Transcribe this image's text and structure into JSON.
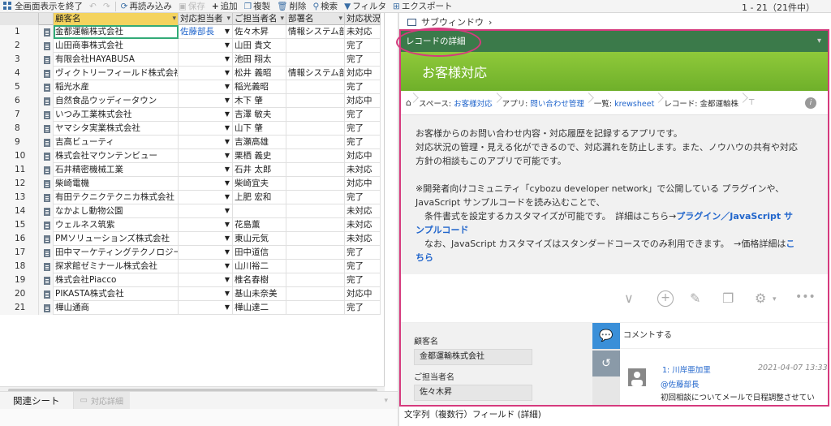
{
  "toolbar": {
    "exit_fullscreen": "全画面表示を終了",
    "reload": "再読み込み",
    "save": "保存",
    "add": "追加",
    "duplicate": "複製",
    "delete": "削除",
    "search": "検索",
    "filter": "フィルタ",
    "export": "エクスポート",
    "range": "1 - 21（21件中）"
  },
  "grid": {
    "headers": [
      "顧客名",
      "対応担当者",
      "ご担当者名",
      "部署名",
      "対応状況"
    ],
    "rows": [
      {
        "n": "1",
        "name": "金都運輸株式会社",
        "rep": "佐藤部長",
        "contact": "佐々木昇",
        "dept": "情報システム部",
        "status": "未対応"
      },
      {
        "n": "2",
        "name": "山田商事株式会社",
        "rep": "",
        "contact": "山田 貴文",
        "dept": "",
        "status": "完了"
      },
      {
        "n": "3",
        "name": "有限会社HAYABUSA",
        "rep": "",
        "contact": "池田 翔太",
        "dept": "",
        "status": "完了"
      },
      {
        "n": "4",
        "name": "ヴィクトリーフィールド株式会社",
        "rep": "",
        "contact": "松井 義昭",
        "dept": "情報システム部",
        "status": "対応中"
      },
      {
        "n": "5",
        "name": "稲光水産",
        "rep": "",
        "contact": "稲光義昭",
        "dept": "",
        "status": "完了"
      },
      {
        "n": "6",
        "name": " 自然食品ウッディータウン",
        "rep": "",
        "contact": "木下 肇",
        "dept": "",
        "status": "対応中"
      },
      {
        "n": "7",
        "name": "いつみ工業株式会社",
        "rep": "",
        "contact": "吉澤 敏夫",
        "dept": "",
        "status": "完了"
      },
      {
        "n": "8",
        "name": "ヤマシタ実業株式会社",
        "rep": "",
        "contact": "山下 肇",
        "dept": "",
        "status": "完了"
      },
      {
        "n": "9",
        "name": "吉高ビューティ",
        "rep": "",
        "contact": "吉瀬高雄",
        "dept": "",
        "status": "完了"
      },
      {
        "n": "10",
        "name": "株式会社マウンテンビュー",
        "rep": "",
        "contact": "栗栖 義史",
        "dept": "",
        "status": "対応中"
      },
      {
        "n": "11",
        "name": "石井精密機械工業",
        "rep": "",
        "contact": "石井 太郎",
        "dept": "",
        "status": "未対応"
      },
      {
        "n": "12",
        "name": "柴崎電機",
        "rep": "",
        "contact": "柴崎宜夫",
        "dept": "",
        "status": "対応中"
      },
      {
        "n": "13",
        "name": "有田テクニクテクニカ株式会社",
        "rep": "",
        "contact": "上肥 宏和",
        "dept": "",
        "status": "完了"
      },
      {
        "n": "14",
        "name": "なかよし動物公園",
        "rep": "",
        "contact": "",
        "dept": "",
        "status": "未対応"
      },
      {
        "n": "15",
        "name": "ウェルネス筑紫",
        "rep": "",
        "contact": "花島薫",
        "dept": "",
        "status": "未対応"
      },
      {
        "n": "16",
        "name": "PMソリューションズ株式会社",
        "rep": "",
        "contact": "東山元気",
        "dept": "",
        "status": "未対応"
      },
      {
        "n": "17",
        "name": "田中マーケティングテクノロジー",
        "rep": "",
        "contact": "田中道信",
        "dept": "",
        "status": "完了"
      },
      {
        "n": "18",
        "name": "探求館ゼミナール株式会社",
        "rep": "",
        "contact": "山川裕二",
        "dept": "",
        "status": "完了"
      },
      {
        "n": "19",
        "name": "株式会社Piacco",
        "rep": "",
        "contact": "椎名春樹",
        "dept": "",
        "status": "完了"
      },
      {
        "n": "20",
        "name": "PIKASTA株式会社",
        "rep": "",
        "contact": "基山未奈美",
        "dept": "",
        "status": "対応中"
      },
      {
        "n": "21",
        "name": "樺山通商",
        "rep": "",
        "contact": "樺山達二",
        "dept": "",
        "status": "完了"
      }
    ]
  },
  "bottom": {
    "related_sheet": "関連シート",
    "detail_tab": "対応詳細"
  },
  "subwindow": {
    "title": "サブウィンドウ"
  },
  "detail": {
    "header": "レコードの詳細",
    "app_title": "お客様対応",
    "breadcrumbs": [
      {
        "prefix": "スペース: ",
        "link": "お客様対応"
      },
      {
        "prefix": "アプリ: ",
        "link": "問い合わせ管理"
      },
      {
        "prefix": "一覧: ",
        "link": "krewsheet"
      },
      {
        "prefix": "レコード: ",
        "link": "",
        "plain": "金都運輸株"
      }
    ],
    "desc_lines": [
      "お客様からのお問い合わせ内容・対応履歴を記録するアプリです。",
      "対応状況の管理・見える化ができるので、対応漏れを防止します。また、ノウハウの共有や対応",
      "方針の相談もこのアプリで可能です。"
    ],
    "dev_line1": "※開発者向けコミュニティ「cybozu developer network」で公開している プラグインや、",
    "dev_line2": "JavaScript サンプルコードを読み込むことで、",
    "dev_line3a": "　条件書式を設定するカスタマイズが可能です。　詳細はこちら→",
    "dev_link1": "プラグイン",
    "dev_slash": "／",
    "dev_link2a": "JavaScript サ",
    "dev_link2b": "ンプルコード",
    "dev_line4": "　なお、JavaScript カスタマイズはスタンダードコースでのみ利用できます。　→価格詳細は",
    "dev_link3a": "こ",
    "dev_link3b": "ちら"
  },
  "form": {
    "customer_label": "顧客名",
    "customer_value": "金都運輸株式会社",
    "contact_label": "ご担当者名",
    "contact_value": "佐々木昇"
  },
  "comments": {
    "placeholder": "コメントする",
    "item": {
      "author": "1: 川岸亜加里",
      "date": "2021-04-07 13:33",
      "mention": "@佐藤部長",
      "text": "初回相談についてメールで日程調整させてい"
    }
  },
  "statusbar": {
    "text": "文字列（複数行）フィールド (詳細)"
  },
  "colors": {
    "accent_pink": "#d63a7e",
    "green_header": "#3b7a4a",
    "banner_green": "#7cbc30",
    "link_blue": "#2266cc",
    "comment_blue": "#3a8fd8",
    "history_gray": "#8a9aa8"
  }
}
